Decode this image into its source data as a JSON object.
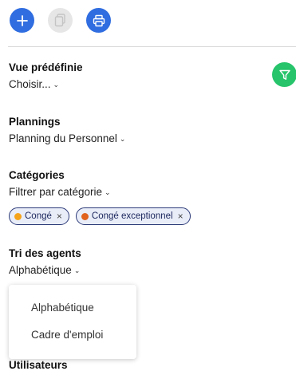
{
  "toolbar": {
    "add_icon": "plus-icon",
    "copy_icon": "copy-icon",
    "print_icon": "printer-icon"
  },
  "filter_icon": "filter-icon",
  "preset_view": {
    "title": "Vue prédéfinie",
    "value": "Choisir..."
  },
  "plannings": {
    "title": "Plannings",
    "value": "Planning du Personnel"
  },
  "categories": {
    "title": "Catégories",
    "value": "Filtrer par catégorie",
    "chips": [
      {
        "label": "Congé",
        "color": "#f5a31a"
      },
      {
        "label": "Congé exceptionnel",
        "color": "#e0621d"
      }
    ]
  },
  "sort_agents": {
    "title": "Tri des agents",
    "value": "Alphabétique",
    "options": [
      "Alphabétique",
      "Cadre d'emploi"
    ]
  },
  "users": {
    "title": "Utilisateurs"
  },
  "colors": {
    "primary": "#2f6de0",
    "filter": "#27c46b"
  }
}
